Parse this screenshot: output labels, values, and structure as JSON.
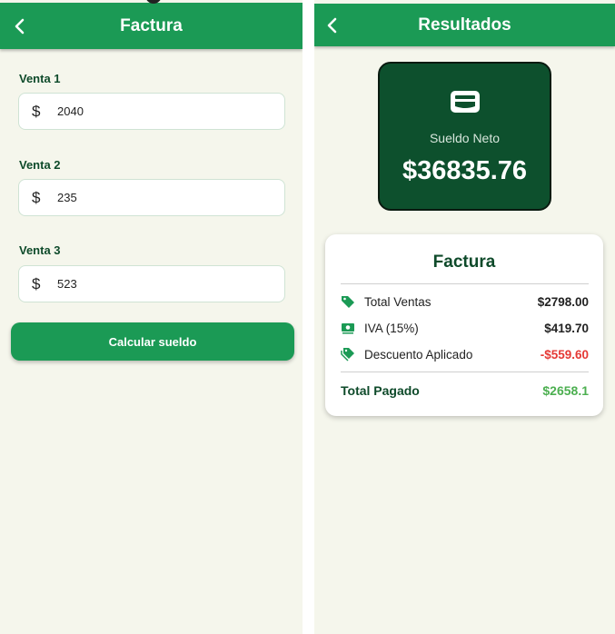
{
  "left_screen": {
    "title": "Factura",
    "fields": [
      {
        "label": "Venta 1",
        "prefix": "$",
        "value": "2040"
      },
      {
        "label": "Venta 2",
        "prefix": "$",
        "value": "235"
      },
      {
        "label": "Venta 3",
        "prefix": "$",
        "value": "523"
      }
    ],
    "button_label": "Calcular sueldo"
  },
  "right_screen": {
    "title": "Resultados",
    "net_salary": {
      "label": "Sueldo Neto",
      "value": "$36835.76",
      "icon": "wallet-icon"
    },
    "invoice": {
      "title": "Factura",
      "rows": [
        {
          "label": "Total Ventas",
          "amount": "$2798.00",
          "icon": "tag-icon"
        },
        {
          "label": "IVA (15%)",
          "amount": "$419.70",
          "icon": "money-icon"
        },
        {
          "label": "Descuento Aplicado",
          "amount": "-$559.60",
          "icon": "discount-tag-icon"
        }
      ],
      "total_label": "Total Pagado",
      "total_amount": "$2658.1"
    }
  },
  "colors": {
    "primary": "#1b9a55",
    "dark_green": "#0d502d",
    "background": "#f5f6ec",
    "negative": "#e53935",
    "total": "#4caf50"
  }
}
